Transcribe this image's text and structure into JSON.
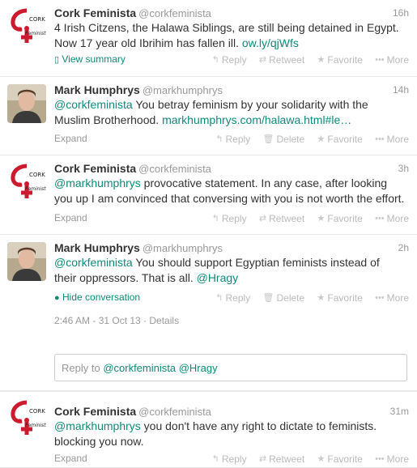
{
  "tweets": [
    {
      "name": "Cork Feminista",
      "handle": "@corkfeminista",
      "time": "16h",
      "text_line1": "4 Irish Citzens, the Halawa Siblings, are still being detained in Egypt.",
      "text_line2_plain": "Now 17 year old Ibrihim has fallen ill. ",
      "text_line2_link": "ow.ly/qjWfs",
      "expand": "View summary",
      "actions": [
        "Reply",
        "Retweet",
        "Favorite",
        "More"
      ]
    },
    {
      "name": "Mark Humphrys",
      "handle": "@markhumphrys",
      "time": "14h",
      "mention": "@corkfeminista",
      "text_line1_plain": " You betray feminism by your solidarity with the",
      "text_line2_plain": "Muslim Brotherhood. ",
      "text_line2_link": "markhumphrys.com/halawa.html#le…",
      "expand": "Expand",
      "actions": [
        "Reply",
        "Delete",
        "Favorite",
        "More"
      ]
    },
    {
      "name": "Cork Feminista",
      "handle": "@corkfeminista",
      "time": "3h",
      "mention": "@markhumphrys",
      "text_line1_plain": " provocative statement. In any case, after looking",
      "text_line2_plain": "you up I am convinced that conversing with you is not worth the effort.",
      "expand": "Expand",
      "actions": [
        "Reply",
        "Retweet",
        "Favorite",
        "More"
      ]
    },
    {
      "name": "Mark Humphrys",
      "handle": "@markhumphrys",
      "time": "2h",
      "mention": "@corkfeminista",
      "text_line1_plain": " You should support Egyptian feminists instead of",
      "text_line2_plain": "their oppressors. That is all. ",
      "text_line2_link": "@Hragy",
      "expand": "Hide conversation",
      "actions": [
        "Reply",
        "Delete",
        "Favorite",
        "More"
      ],
      "timestamp": "2:46 AM - 31 Oct 13 · Details"
    },
    {
      "name": "Cork Feminista",
      "handle": "@corkfeminista",
      "time": "31m",
      "mention": "@markhumphrys",
      "text_line1_plain": " you don't have any right to dictate to feminists.",
      "text_line2_plain": "blocking you now.",
      "expand": "Expand",
      "actions": [
        "Reply",
        "Retweet",
        "Favorite",
        "More"
      ]
    }
  ],
  "reply_box": {
    "prefix": "Reply to ",
    "mentions": "@corkfeminista @Hragy"
  },
  "logo_text": "CORK FEMINISTA",
  "icons": {
    "reply": "reply-arrow-icon",
    "retweet": "retweet-icon",
    "delete": "trash-icon",
    "favorite": "star-icon",
    "more": "ellipsis-icon",
    "summary": "document-icon",
    "conversation": "speech-bubble-icon"
  },
  "colors": {
    "link": "#0e8a7a",
    "logo_red": "#cc1b2e",
    "muted": "#999999"
  }
}
